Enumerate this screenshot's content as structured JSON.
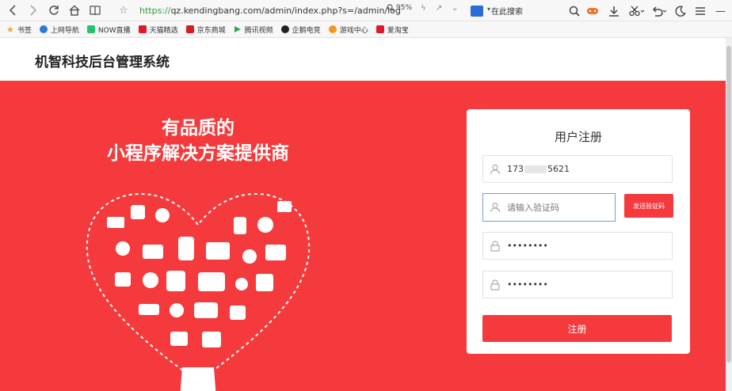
{
  "browser": {
    "url_scheme": "https://",
    "url_rest": "qz.kendingbang.com/admin/index.php?s=/admin/log",
    "zoom": "95%",
    "search_placeholder": "在此搜索"
  },
  "bookmarks": [
    {
      "label": "书签",
      "icon": "star-icon",
      "color": "#f5a623"
    },
    {
      "label": "上网导航",
      "icon": "ie-icon",
      "color": "#2b7bd6"
    },
    {
      "label": "NOW直播",
      "icon": "now-icon",
      "color": "#22c36e"
    },
    {
      "label": "天猫精选",
      "icon": "tmall-icon",
      "color": "#e0182b"
    },
    {
      "label": "京东商城",
      "icon": "jd-icon",
      "color": "#d61d1d"
    },
    {
      "label": "腾讯视频",
      "icon": "video-icon",
      "color": "#31a84e"
    },
    {
      "label": "企鹅电竞",
      "icon": "penguin-icon",
      "color": "#222222"
    },
    {
      "label": "游戏中心",
      "icon": "game-icon",
      "color": "#f19a1a"
    },
    {
      "label": "爱淘宝",
      "icon": "taobao-icon",
      "color": "#e0182b"
    }
  ],
  "site": {
    "title": "机智科技后台管理系统"
  },
  "banner": {
    "slogan_line1": "有品质的",
    "slogan_line2": "小程序解决方案提供商",
    "background": "#f43a3c"
  },
  "register": {
    "title": "用户注册",
    "phone_prefix": "173",
    "phone_suffix": "5621",
    "code_placeholder": "请输入验证码",
    "send_code_label": "发送验证码",
    "password": "••••••••",
    "confirm_password": "••••••••",
    "submit_label": "注册"
  }
}
